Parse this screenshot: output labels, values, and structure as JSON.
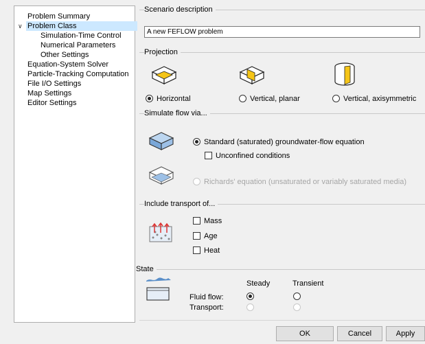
{
  "tree": {
    "items": [
      {
        "label": "Problem Summary",
        "indent": 0
      },
      {
        "label": "Problem Class",
        "indent": 0,
        "selected": true,
        "expanded": true
      },
      {
        "label": "Simulation-Time Control",
        "indent": 2
      },
      {
        "label": "Numerical Parameters",
        "indent": 2
      },
      {
        "label": "Other Settings",
        "indent": 2
      },
      {
        "label": "Equation-System Solver",
        "indent": 0
      },
      {
        "label": "Particle-Tracking Computation",
        "indent": 0
      },
      {
        "label": "File I/O Settings",
        "indent": 0
      },
      {
        "label": "Map Settings",
        "indent": 0
      },
      {
        "label": "Editor Settings",
        "indent": 0
      }
    ],
    "expander_icon": "chevron-down-icon"
  },
  "scenario": {
    "title": "Scenario description",
    "value": "A new FEFLOW problem"
  },
  "projection": {
    "title": "Projection",
    "options": [
      {
        "label": "Horizontal",
        "selected": true,
        "icon": "horizontal-projection-icon"
      },
      {
        "label": "Vertical, planar",
        "selected": false,
        "icon": "vertical-planar-icon"
      },
      {
        "label": "Vertical, axisymmetric",
        "selected": false,
        "icon": "vertical-axisymmetric-icon"
      }
    ]
  },
  "flow": {
    "title": "Simulate flow via...",
    "standard_label": "Standard (saturated) groundwater-flow equation",
    "standard_selected": true,
    "unconfined_label": "Unconfined conditions",
    "unconfined_checked": false,
    "richards_label": "Richards' equation (unsaturated or variably saturated media)",
    "richards_selected": false,
    "richards_enabled": false
  },
  "transport": {
    "title": "Include transport of...",
    "options": [
      {
        "label": "Mass",
        "checked": false
      },
      {
        "label": "Age",
        "checked": false
      },
      {
        "label": "Heat",
        "checked": false
      }
    ]
  },
  "state": {
    "title": "State",
    "col_steady": "Steady",
    "col_transient": "Transient",
    "row_fluid": "Fluid flow:",
    "row_transport": "Transport:",
    "fluid_steady": true,
    "transport_enabled": false
  },
  "buttons": {
    "ok": "OK",
    "cancel": "Cancel",
    "apply": "Apply"
  },
  "colors": {
    "accent": "#f5c518",
    "blue": "#7aa7d8",
    "selection": "#cce8ff"
  }
}
